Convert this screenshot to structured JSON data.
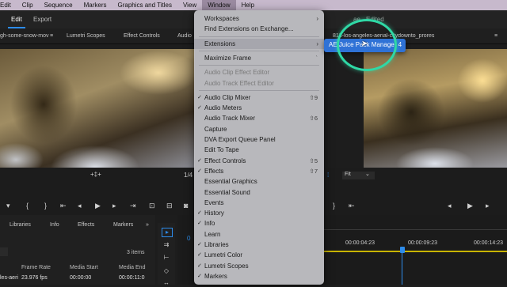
{
  "menubar": {
    "items": [
      "Edit",
      "Clip",
      "Sequence",
      "Markers",
      "Graphics and Titles",
      "View",
      "Window",
      "Help"
    ],
    "active": "Window"
  },
  "workspace": {
    "tabs": [
      "Edit",
      "Export"
    ],
    "program_title": "ae - Edited"
  },
  "panels": {
    "source_clip": "gh-some-snow-mov",
    "tab_lumetri": "Lumetri Scopes",
    "tab_effect_controls": "Effect Controls",
    "tab_audio": "Audio",
    "program_clip": "813-los-angeles-aerial-citydownto_prores"
  },
  "source_viewer": {
    "zoom_fraction": "1/4",
    "timecode_glyph": "+‡+"
  },
  "program_viewer": {
    "fit": "Fit"
  },
  "project_panel": {
    "tabs": [
      "Libraries",
      "Info",
      "Effects",
      "Markers"
    ],
    "items_count": "3 items",
    "columns": [
      "Frame Rate",
      "Media Start",
      "Media End"
    ],
    "row": {
      "name": "les-aeri",
      "frame_rate": "23.976 fps",
      "media_start": "00:00:00",
      "media_end": "00:00:11:0"
    }
  },
  "timeline": {
    "playhead": "0",
    "timecodes": [
      "00:00:04:23",
      "00:00:09:23",
      "00:00:14:23"
    ]
  },
  "window_menu": {
    "items": [
      {
        "label": "Workspaces",
        "submenu": true
      },
      {
        "label": "Find Extensions on Exchange..."
      },
      {
        "sep": true
      },
      {
        "label": "Extensions",
        "submenu": true,
        "highlighted": true
      },
      {
        "sep": true
      },
      {
        "label": "Maximize Frame",
        "shortcut": "`"
      },
      {
        "sep": true
      },
      {
        "label": "Audio Clip Effect Editor",
        "disabled": true
      },
      {
        "label": "Audio Track Effect Editor",
        "disabled": true
      },
      {
        "sep": true
      },
      {
        "label": "Audio Clip Mixer",
        "checked": true,
        "shortcut": "⇧9"
      },
      {
        "label": "Audio Meters",
        "checked": true
      },
      {
        "label": "Audio Track Mixer",
        "shortcut": "⇧6"
      },
      {
        "label": "Capture"
      },
      {
        "label": "DVA Export Queue Panel"
      },
      {
        "label": "Edit To Tape"
      },
      {
        "label": "Effect Controls",
        "checked": true,
        "shortcut": "⇧5"
      },
      {
        "label": "Effects",
        "checked": true,
        "shortcut": "⇧7"
      },
      {
        "label": "Essential Graphics"
      },
      {
        "label": "Essential Sound"
      },
      {
        "label": "Events"
      },
      {
        "label": "History",
        "checked": true
      },
      {
        "label": "Info",
        "checked": true
      },
      {
        "label": "Learn"
      },
      {
        "label": "Libraries",
        "checked": true
      },
      {
        "label": "Lumetri Color",
        "checked": true
      },
      {
        "label": "Lumetri Scopes",
        "checked": true
      },
      {
        "label": "Markers",
        "checked": true
      }
    ]
  },
  "extensions_submenu": {
    "items": [
      "AE Juice Pack Manager 4"
    ]
  },
  "colors": {
    "menubar": "#c7b9cc",
    "menu_bg": "#c4c4c8",
    "submenu_highlight": "#2f72d6",
    "cursor_ring": "#2fd8a5",
    "accent": "#2d8ceb"
  }
}
